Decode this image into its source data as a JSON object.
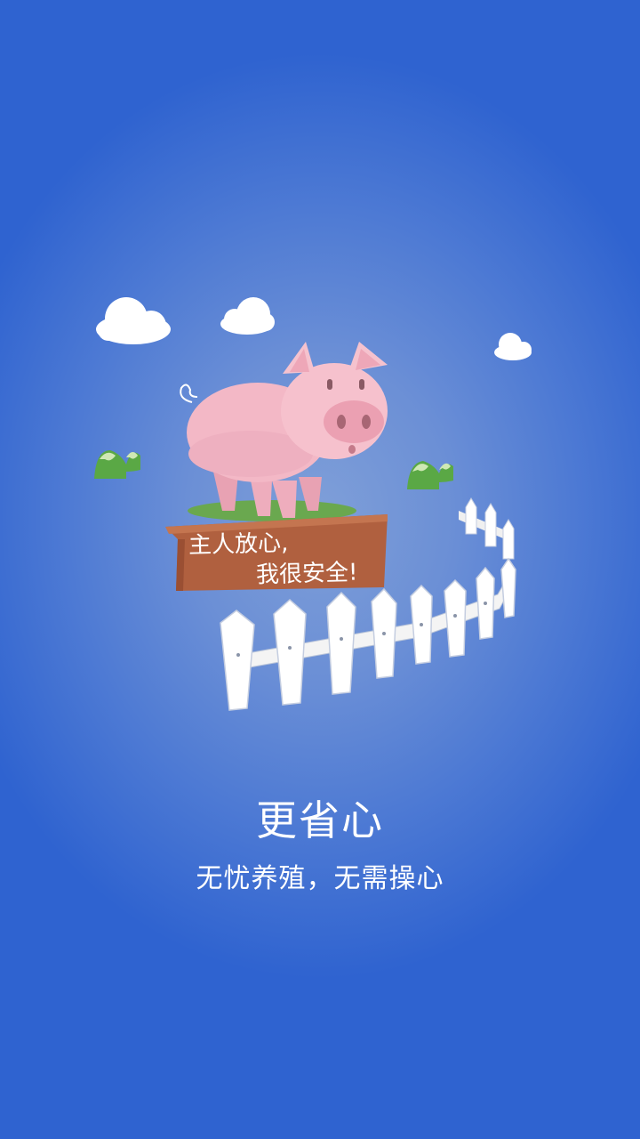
{
  "sign": {
    "line1": "主人放心,",
    "line2": "我很安全!"
  },
  "headline": "更省心",
  "subline": "无忧养殖，无需操心",
  "colors": {
    "background_center": "#7f9fd8",
    "background_edge": "#2f63d0",
    "pig": "#f3b8c6",
    "sign": "#b0603f",
    "grass": "#5aa845",
    "text": "#ffffff"
  }
}
